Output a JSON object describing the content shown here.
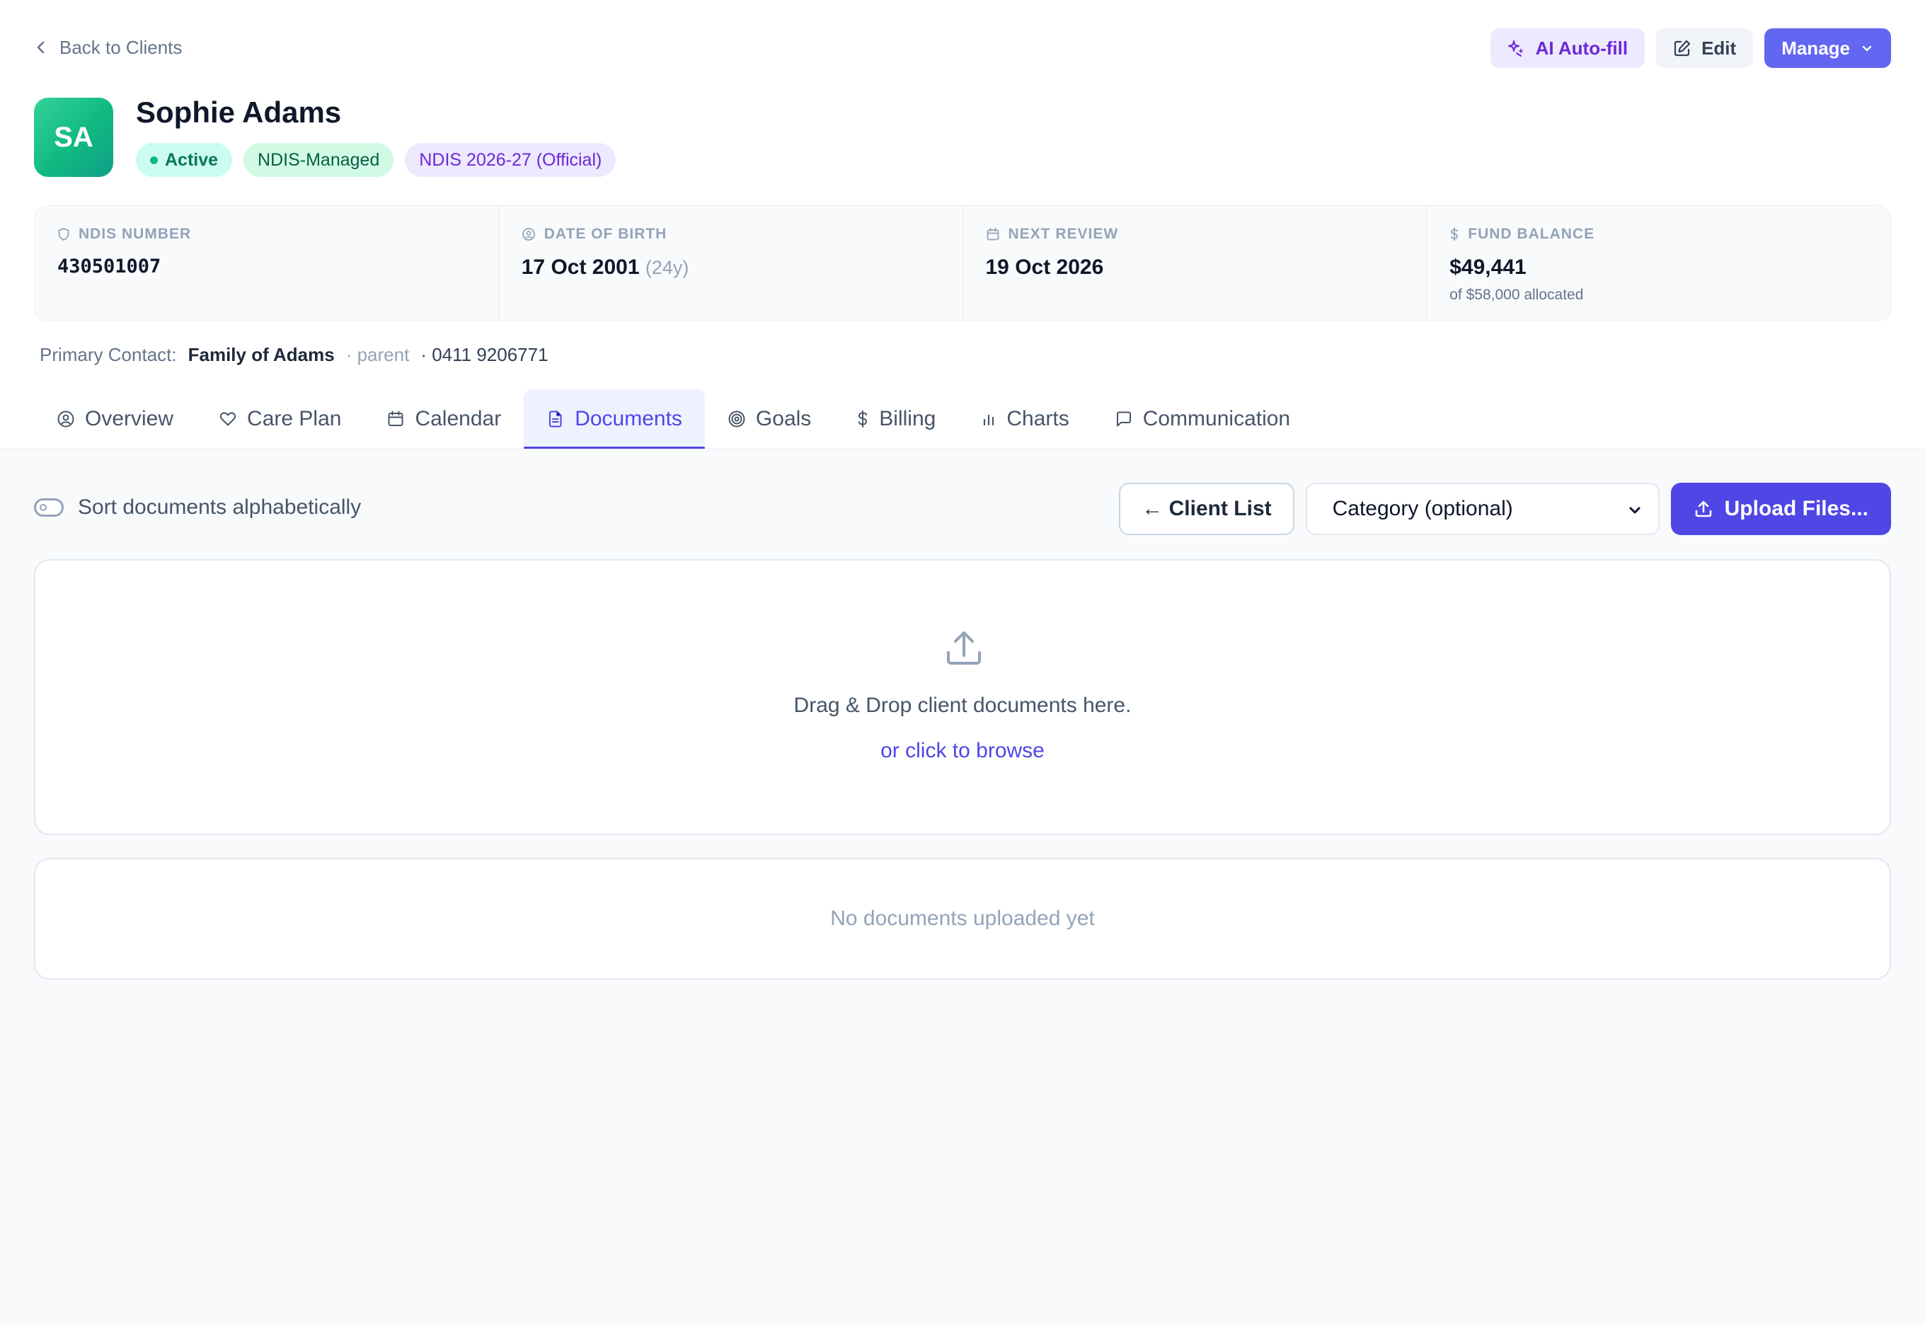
{
  "header": {
    "back_label": "Back to Clients",
    "actions": {
      "ai_autofill": "AI Auto-fill",
      "edit": "Edit",
      "manage": "Manage"
    }
  },
  "client": {
    "initials": "SA",
    "name": "Sophie Adams",
    "badges": {
      "status": "Active",
      "management": "NDIS-Managed",
      "plan": "NDIS 2026-27 (Official)"
    }
  },
  "stats": {
    "ndis_number": {
      "label": "NDIS NUMBER",
      "value": "430501007"
    },
    "date_of_birth": {
      "label": "DATE OF BIRTH",
      "value": "17 Oct 2001",
      "age": "(24y)"
    },
    "next_review": {
      "label": "NEXT REVIEW",
      "value": "19 Oct 2026"
    },
    "fund_balance": {
      "label": "FUND BALANCE",
      "value": "$49,441",
      "note": "of $58,000 allocated"
    }
  },
  "primary_contact": {
    "label": "Primary Contact:",
    "name": "Family of Adams",
    "relationship": "· parent",
    "phone": "· 0411 9206771"
  },
  "tabs": [
    {
      "label": "Overview",
      "icon": "user-circle-icon"
    },
    {
      "label": "Care Plan",
      "icon": "heart-icon"
    },
    {
      "label": "Calendar",
      "icon": "calendar-icon"
    },
    {
      "label": "Documents",
      "icon": "document-icon",
      "active": true
    },
    {
      "label": "Goals",
      "icon": "target-icon"
    },
    {
      "label": "Billing",
      "icon": "dollar-icon"
    },
    {
      "label": "Charts",
      "icon": "bar-chart-icon"
    },
    {
      "label": "Communication",
      "icon": "message-icon"
    }
  ],
  "documents": {
    "sort_label": "Sort documents alphabetically",
    "client_list_button": "← Client List",
    "category_select": "Category (optional)",
    "upload_button": "Upload Files...",
    "dropzone_text": "Drag & Drop client documents here.",
    "dropzone_browse": "or click to browse",
    "empty_state": "No documents uploaded yet"
  },
  "colors": {
    "accent": "#4f46e5",
    "manage_button": "#6366f1",
    "avatar_gradient_start": "#34d399",
    "avatar_gradient_end": "#0f9f8a",
    "active_badge_bg": "#ccfbf1",
    "plan_badge_bg": "#ede9fe"
  }
}
